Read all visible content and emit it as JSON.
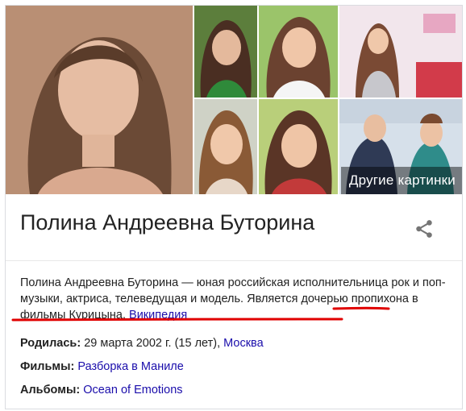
{
  "gallery": {
    "more_images_label": "Другие картинки"
  },
  "entity": {
    "title": "Полина Андреевна Буторина",
    "description_text": "Полина Андреевна Буторина — юная российская исполнительница рок и поп-музыки, актриса, телеведущая и модель. Является дочерью пропихона в фильмы Курицына.",
    "source_link": "Википедия"
  },
  "facts": [
    {
      "label": "Родилась:",
      "value": "29 марта 2002 г. (15 лет),",
      "link": "Москва"
    },
    {
      "label": "Фильмы:",
      "value": "",
      "link": "Разборка в Маниле"
    },
    {
      "label": "Альбомы:",
      "value": "",
      "link": "Ocean of Emotions"
    }
  ],
  "colors": {
    "link": "#1a0dab",
    "annotation_red": "#e00000",
    "text": "#222222"
  }
}
